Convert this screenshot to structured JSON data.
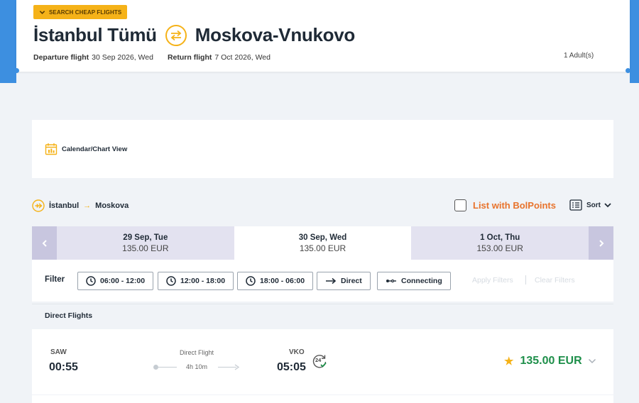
{
  "header": {
    "cheap_flights_label": "SEARCH CHEAP FLIGHTS",
    "origin": "İstanbul Tümü",
    "destination": "Moskova-Vnukovo",
    "departure_label": "Departure flight",
    "departure_date": "30 Sep 2026, Wed",
    "return_label": "Return flight",
    "return_date": "7 Oct 2026, Wed",
    "passengers": "1 Adult(s)"
  },
  "calendar": {
    "label": "Calendar/Chart View"
  },
  "route": {
    "from": "İstanbul",
    "to": "Moskova",
    "bolpoints_label": "List with BolPoints",
    "sort_label": "Sort"
  },
  "date_strip": [
    {
      "date": "29 Sep, Tue",
      "price": "135.00 EUR",
      "active": false
    },
    {
      "date": "30 Sep, Wed",
      "price": "135.00 EUR",
      "active": true
    },
    {
      "date": "1 Oct, Thu",
      "price": "153.00 EUR",
      "active": false
    }
  ],
  "filters": {
    "label": "Filter",
    "buttons": [
      "06:00 - 12:00",
      "12:00 - 18:00",
      "18:00 - 06:00",
      "Direct",
      "Connecting"
    ],
    "apply_label": "Apply Filters",
    "clear_label": "Clear Filters"
  },
  "results": {
    "section_title": "Direct Flights",
    "flights": [
      {
        "dep_code": "SAW",
        "dep_time": "00:55",
        "type": "Direct Flight",
        "duration": "4h 10m",
        "arr_code": "VKO",
        "arr_time": "05:05",
        "badge": "24",
        "price": "135.00 EUR"
      }
    ]
  },
  "colors": {
    "accent": "#f5b218",
    "brand_blue": "#3d8fe0",
    "price_green": "#1e8f4a",
    "bolpoints_orange": "#e8732c"
  }
}
